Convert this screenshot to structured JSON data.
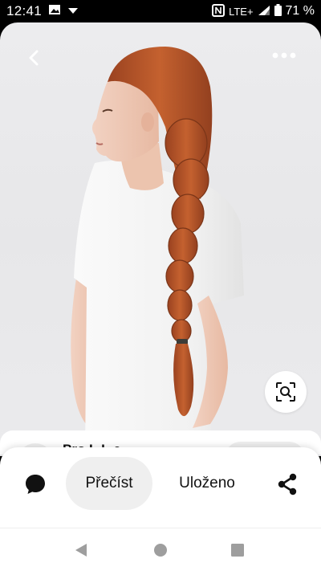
{
  "status_bar": {
    "time": "12:41",
    "network": "LTE+",
    "battery": "71 %",
    "icons": [
      "image-icon",
      "dropdown-icon",
      "nfc-icon",
      "signal-icon",
      "battery-icon"
    ]
  },
  "pin": {
    "creator_name": "Pro L.L.e",
    "image_icon_names": [
      "back-arrow-icon",
      "more-dots-icon",
      "visual-search-icon"
    ]
  },
  "actions": {
    "comment_icon": "comment-bubble-icon",
    "read_label": "Přečíst",
    "saved_label": "Uloženo",
    "share_icon": "share-icon"
  },
  "navigation": {
    "icons": [
      "back-triangle-icon",
      "home-circle-icon",
      "recents-square-icon"
    ]
  },
  "colors": {
    "status_bar": "#000000",
    "pill_background": "#efefef",
    "text": "#111111",
    "hair": "#b4542a",
    "shirt": "#f6f6f6",
    "image_background": "#eaeaec"
  }
}
